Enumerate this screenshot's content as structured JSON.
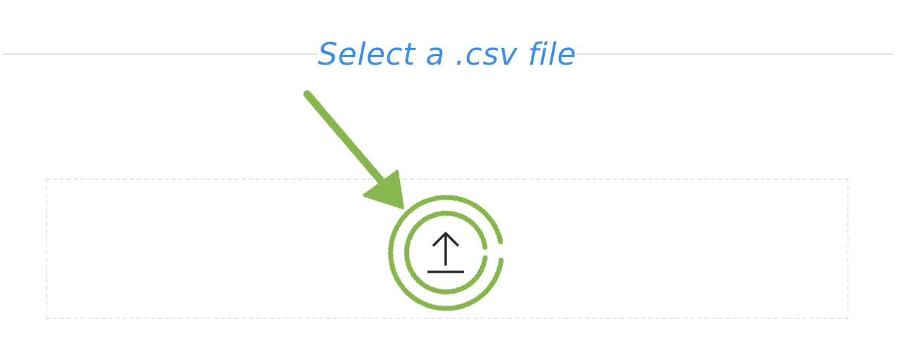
{
  "header": {
    "title": "Select a .csv file"
  },
  "upload": {
    "icon": "upload-icon"
  },
  "annotation": {
    "arrow": "hand-drawn-arrow",
    "circle": "hand-drawn-circles"
  },
  "colors": {
    "title": "#3d8ee5",
    "divider": "#e3e3e3",
    "dropzone_border": "#e9e9e9",
    "annotation": "#86b64e",
    "icon": "#2b2b2b"
  }
}
